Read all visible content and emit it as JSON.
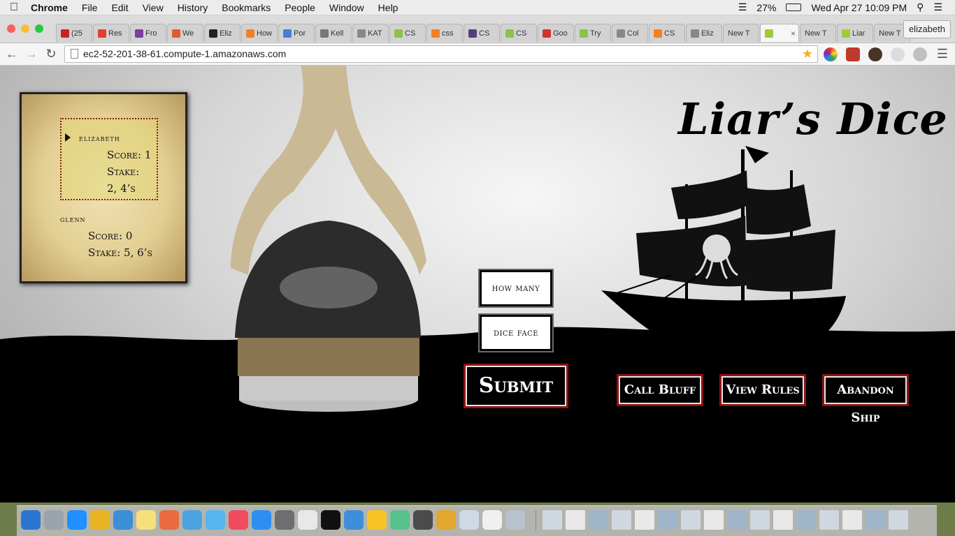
{
  "menubar": {
    "app_name": "Chrome",
    "items": [
      "File",
      "Edit",
      "View",
      "History",
      "Bookmarks",
      "People",
      "Window",
      "Help"
    ],
    "battery": "27%",
    "datetime": "Wed Apr 27  10:09 PM"
  },
  "tabs": [
    {
      "label": "(25",
      "color": "#cb2027"
    },
    {
      "label": "Res",
      "color": "#e0402c"
    },
    {
      "label": "Fro",
      "color": "#7a3fa0"
    },
    {
      "label": "We",
      "color": "#e25b2f"
    },
    {
      "label": "Eliz",
      "color": "#222222"
    },
    {
      "label": "How",
      "color": "#f48024"
    },
    {
      "label": "Por",
      "color": "#4a7bd8"
    },
    {
      "label": "Kell",
      "color": "#777777"
    },
    {
      "label": "KAT",
      "color": "#888888"
    },
    {
      "label": "CS",
      "color": "#8bc34a"
    },
    {
      "label": "css",
      "color": "#f48024"
    },
    {
      "label": "CS",
      "color": "#563d7c"
    },
    {
      "label": "CS",
      "color": "#8bc34a"
    },
    {
      "label": "Goo",
      "color": "#d0342c"
    },
    {
      "label": "Try",
      "color": "#8bc34a"
    },
    {
      "label": "Col",
      "color": "#888888"
    },
    {
      "label": "CS",
      "color": "#f48024"
    },
    {
      "label": "Eliz",
      "color": "#888888"
    },
    {
      "label": "New T",
      "color": ""
    },
    {
      "label": "",
      "color": "#9ccc3c",
      "active": true
    },
    {
      "label": "New T",
      "color": ""
    },
    {
      "label": "Liar",
      "color": "#9ccc3c"
    },
    {
      "label": "New T",
      "color": ""
    }
  ],
  "profile": "elizabeth",
  "url": "ec2-52-201-38-61.compute-1.amazonaws.com",
  "game": {
    "title": "Liar’s Dice",
    "players": [
      {
        "name": "elizabeth",
        "score": "Score: 1",
        "stake_label": "Stake:",
        "stake": "2, 4’s",
        "active": true
      },
      {
        "name": "glenn",
        "score": "Score: 0",
        "stake": "Stake: 5, 6’s",
        "active": false
      }
    ],
    "how_many_label": "how many",
    "dice_face_label": "dice face",
    "submit_label": "Submit",
    "call_bluff_label": "Call Bluff",
    "view_rules_label": "View Rules",
    "abandon_ship_label": "Abandon Ship"
  }
}
